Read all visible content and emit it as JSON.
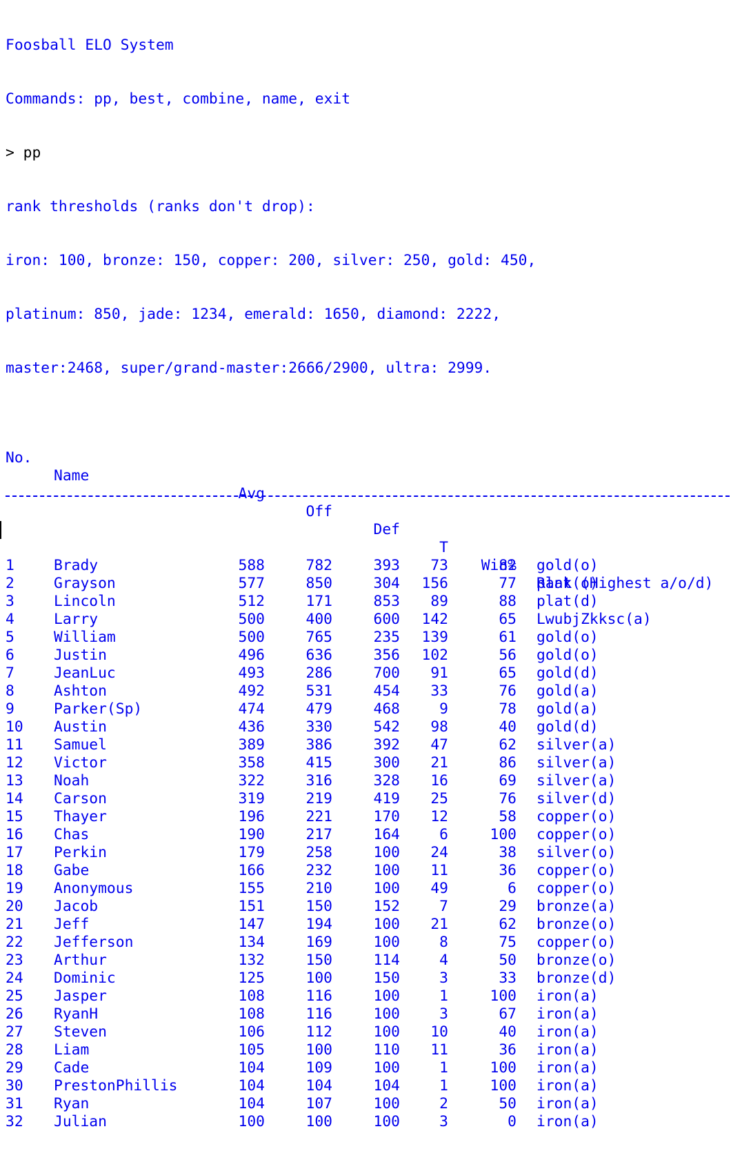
{
  "header": {
    "title": "Foosball ELO System",
    "commands": "Commands: pp, best, combine, name, exit",
    "prompt": "> ",
    "input": "pp"
  },
  "thresholds": {
    "heading": "rank thresholds (ranks don't drop):",
    "line1": "iron: 100, bronze: 150, copper: 200, silver: 250, gold: 450,",
    "line2": "platinum: 850, jade: 1234, emerald: 1650, diamond: 2222,",
    "line3": "master:2468, super/grand-master:2666/2900, ultra: 2999."
  },
  "table": {
    "columns": {
      "no": "No.",
      "name": "Name",
      "avg": "Avg",
      "off": "Off",
      "def": "Def",
      "t": "T",
      "win": "Win%",
      "rank": "Rank (Highest a/o/d)"
    },
    "rows": [
      {
        "no": "1",
        "name": "Brady",
        "avg": "588",
        "off": "782",
        "def": "393",
        "t": "73",
        "win": "82",
        "rank": "gold(o)"
      },
      {
        "no": "2",
        "name": "Grayson",
        "avg": "577",
        "off": "850",
        "def": "304",
        "t": "156",
        "win": "77",
        "rank": "plat(o)"
      },
      {
        "no": "3",
        "name": "Lincoln",
        "avg": "512",
        "off": "171",
        "def": "853",
        "t": "89",
        "win": "88",
        "rank": "plat(d)"
      },
      {
        "no": "4",
        "name": "Larry",
        "avg": "500",
        "off": "400",
        "def": "600",
        "t": "142",
        "win": "65",
        "rank": "LwubjZkksc(a)"
      },
      {
        "no": "5",
        "name": "William",
        "avg": "500",
        "off": "765",
        "def": "235",
        "t": "139",
        "win": "61",
        "rank": "gold(o)"
      },
      {
        "no": "6",
        "name": "Justin",
        "avg": "496",
        "off": "636",
        "def": "356",
        "t": "102",
        "win": "56",
        "rank": "gold(o)"
      },
      {
        "no": "7",
        "name": "JeanLuc",
        "avg": "493",
        "off": "286",
        "def": "700",
        "t": "91",
        "win": "65",
        "rank": "gold(d)"
      },
      {
        "no": "8",
        "name": "Ashton",
        "avg": "492",
        "off": "531",
        "def": "454",
        "t": "33",
        "win": "76",
        "rank": "gold(a)"
      },
      {
        "no": "9",
        "name": "Parker(Sp)",
        "avg": "474",
        "off": "479",
        "def": "468",
        "t": "9",
        "win": "78",
        "rank": "gold(a)"
      },
      {
        "no": "10",
        "name": "Austin",
        "avg": "436",
        "off": "330",
        "def": "542",
        "t": "98",
        "win": "40",
        "rank": "gold(d)"
      },
      {
        "no": "11",
        "name": "Samuel",
        "avg": "389",
        "off": "386",
        "def": "392",
        "t": "47",
        "win": "62",
        "rank": "silver(a)"
      },
      {
        "no": "12",
        "name": "Victor",
        "avg": "358",
        "off": "415",
        "def": "300",
        "t": "21",
        "win": "86",
        "rank": "silver(a)"
      },
      {
        "no": "13",
        "name": "Noah",
        "avg": "322",
        "off": "316",
        "def": "328",
        "t": "16",
        "win": "69",
        "rank": "silver(a)"
      },
      {
        "no": "14",
        "name": "Carson",
        "avg": "319",
        "off": "219",
        "def": "419",
        "t": "25",
        "win": "76",
        "rank": "silver(d)"
      },
      {
        "no": "15",
        "name": "Thayer",
        "avg": "196",
        "off": "221",
        "def": "170",
        "t": "12",
        "win": "58",
        "rank": "copper(o)"
      },
      {
        "no": "16",
        "name": "Chas",
        "avg": "190",
        "off": "217",
        "def": "164",
        "t": "6",
        "win": "100",
        "rank": "copper(o)"
      },
      {
        "no": "17",
        "name": "Perkin",
        "avg": "179",
        "off": "258",
        "def": "100",
        "t": "24",
        "win": "38",
        "rank": "silver(o)"
      },
      {
        "no": "18",
        "name": "Gabe",
        "avg": "166",
        "off": "232",
        "def": "100",
        "t": "11",
        "win": "36",
        "rank": "copper(o)"
      },
      {
        "no": "19",
        "name": "Anonymous",
        "avg": "155",
        "off": "210",
        "def": "100",
        "t": "49",
        "win": "6",
        "rank": "copper(o)"
      },
      {
        "no": "20",
        "name": "Jacob",
        "avg": "151",
        "off": "150",
        "def": "152",
        "t": "7",
        "win": "29",
        "rank": "bronze(a)"
      },
      {
        "no": "21",
        "name": "Jeff",
        "avg": "147",
        "off": "194",
        "def": "100",
        "t": "21",
        "win": "62",
        "rank": "bronze(o)"
      },
      {
        "no": "22",
        "name": "Jefferson",
        "avg": "134",
        "off": "169",
        "def": "100",
        "t": "8",
        "win": "75",
        "rank": "copper(o)"
      },
      {
        "no": "23",
        "name": "Arthur",
        "avg": "132",
        "off": "150",
        "def": "114",
        "t": "4",
        "win": "50",
        "rank": "bronze(o)"
      },
      {
        "no": "24",
        "name": "Dominic",
        "avg": "125",
        "off": "100",
        "def": "150",
        "t": "3",
        "win": "33",
        "rank": "bronze(d)"
      },
      {
        "no": "25",
        "name": "Jasper",
        "avg": "108",
        "off": "116",
        "def": "100",
        "t": "1",
        "win": "100",
        "rank": "iron(a)"
      },
      {
        "no": "26",
        "name": "RyanH",
        "avg": "108",
        "off": "116",
        "def": "100",
        "t": "3",
        "win": "67",
        "rank": "iron(a)"
      },
      {
        "no": "27",
        "name": "Steven",
        "avg": "106",
        "off": "112",
        "def": "100",
        "t": "10",
        "win": "40",
        "rank": "iron(a)"
      },
      {
        "no": "28",
        "name": "Liam",
        "avg": "105",
        "off": "100",
        "def": "110",
        "t": "11",
        "win": "36",
        "rank": "iron(a)"
      },
      {
        "no": "29",
        "name": "Cade",
        "avg": "104",
        "off": "109",
        "def": "100",
        "t": "1",
        "win": "100",
        "rank": "iron(a)"
      },
      {
        "no": "30",
        "name": "PrestonPhillis",
        "avg": "104",
        "off": "104",
        "def": "104",
        "t": "1",
        "win": "100",
        "rank": "iron(a)"
      },
      {
        "no": "31",
        "name": "Ryan",
        "avg": "104",
        "off": "107",
        "def": "100",
        "t": "2",
        "win": "50",
        "rank": "iron(a)"
      },
      {
        "no": "32",
        "name": "Julian",
        "avg": "100",
        "off": "100",
        "def": "100",
        "t": "3",
        "win": "0",
        "rank": "iron(a)"
      }
    ]
  }
}
